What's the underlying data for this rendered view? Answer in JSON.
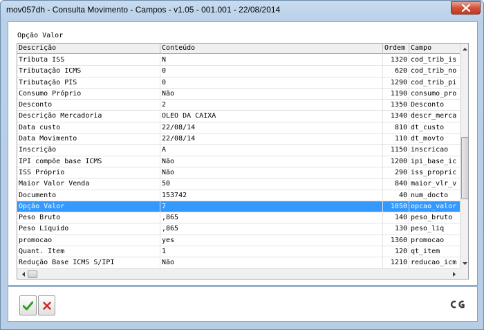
{
  "window": {
    "title": "mov057dh - Consulta Movimento - Campos - v1.05 - 001.001 - 22/08/2014"
  },
  "group": {
    "label": "Opção Valor"
  },
  "grid": {
    "columns": [
      "Descrição",
      "Conteúdo",
      "Ordem",
      "Campo"
    ],
    "rows": [
      {
        "descricao": "Tributa ISS",
        "conteudo": "N",
        "ordem": "1320",
        "campo": "cod_trib_is"
      },
      {
        "descricao": "Tributação ICMS",
        "conteudo": "0",
        "ordem": "620",
        "campo": "cod_trib_no"
      },
      {
        "descricao": "Tributação PIS",
        "conteudo": "0",
        "ordem": "1290",
        "campo": "cod_trib_pi"
      },
      {
        "descricao": "Consumo Próprio",
        "conteudo": "Não",
        "ordem": "1190",
        "campo": "consumo_pro"
      },
      {
        "descricao": "Desconto",
        "conteudo": "2",
        "ordem": "1350",
        "campo": "Desconto"
      },
      {
        "descricao": "Descrição Mercadoria",
        "conteudo": "OLEO DA CAIXA",
        "ordem": "1340",
        "campo": "descr_merca"
      },
      {
        "descricao": "Data custo",
        "conteudo": "22/08/14",
        "ordem": "810",
        "campo": "dt_custo"
      },
      {
        "descricao": "Data Movimento",
        "conteudo": "22/08/14",
        "ordem": "110",
        "campo": "dt_movto"
      },
      {
        "descricao": "Inscrição",
        "conteudo": "A",
        "ordem": "1150",
        "campo": "inscricao"
      },
      {
        "descricao": "IPI compõe base ICMS",
        "conteudo": "Não",
        "ordem": "1200",
        "campo": "ipi_base_ic"
      },
      {
        "descricao": "ISS Próprio",
        "conteudo": "Não",
        "ordem": "290",
        "campo": "iss_propric"
      },
      {
        "descricao": "Maior Valor Venda",
        "conteudo": "50",
        "ordem": "840",
        "campo": "maior_vlr_v"
      },
      {
        "descricao": "Documento",
        "conteudo": "153742",
        "ordem": "40",
        "campo": "num_docto"
      },
      {
        "descricao": "Opção Valor",
        "conteudo": "7",
        "ordem": "1050",
        "campo": "opcao_valor",
        "selected": true
      },
      {
        "descricao": "Peso Bruto",
        "conteudo": ",865",
        "ordem": "140",
        "campo": "peso_bruto"
      },
      {
        "descricao": "Peso Líquido",
        "conteudo": ",865",
        "ordem": "130",
        "campo": "peso_liq"
      },
      {
        "descricao": "promocao",
        "conteudo": "yes",
        "ordem": "1360",
        "campo": "promocao"
      },
      {
        "descricao": "Quant. Item",
        "conteudo": "1",
        "ordem": "120",
        "campo": "qt_item"
      },
      {
        "descricao": "Redução Base ICMS S/IPI",
        "conteudo": "Não",
        "ordem": "1210",
        "campo": "reducao_icm"
      }
    ]
  },
  "footer": {
    "logo_text": "CG"
  },
  "colors": {
    "selection": "#3399ff",
    "ok_icon": "#2e9e1e",
    "cancel_icon": "#d42020"
  },
  "icons": {
    "close": "close-icon",
    "ok": "checkmark-icon",
    "cancel": "x-icon"
  }
}
